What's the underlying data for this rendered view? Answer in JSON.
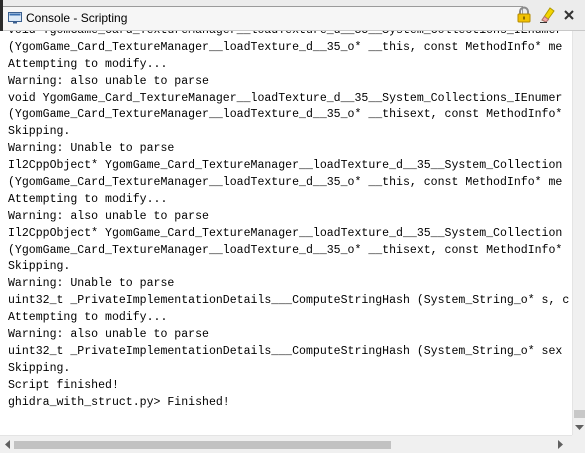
{
  "window": {
    "title": "Console - Scripting"
  },
  "toolbar": {
    "icons": {
      "console": "console-window-icon",
      "lock": "lock-icon",
      "clear": "eraser-icon",
      "close": "close-icon"
    },
    "colors": {
      "lock": "#d9a400",
      "clear": "#e6c400",
      "close": "#333333"
    }
  },
  "console": {
    "lines": [
      "void YgomGame_Card_TextureManager__loadTexture_d__35__System_Collections_IEnumer",
      "(YgomGame_Card_TextureManager__loadTexture_d__35_o* __this, const MethodInfo* me",
      "Attempting to modify...",
      "Warning: also unable to parse",
      "void YgomGame_Card_TextureManager__loadTexture_d__35__System_Collections_IEnumer",
      "(YgomGame_Card_TextureManager__loadTexture_d__35_o* __thisext, const MethodInfo*",
      "Skipping.",
      "Warning: Unable to parse",
      "Il2CppObject* YgomGame_Card_TextureManager__loadTexture_d__35__System_Collection",
      "(YgomGame_Card_TextureManager__loadTexture_d__35_o* __this, const MethodInfo* me",
      "Attempting to modify...",
      "Warning: also unable to parse",
      "Il2CppObject* YgomGame_Card_TextureManager__loadTexture_d__35__System_Collection",
      "(YgomGame_Card_TextureManager__loadTexture_d__35_o* __thisext, const MethodInfo*",
      "Skipping.",
      "Warning: Unable to parse",
      "uint32_t _PrivateImplementationDetails___ComputeStringHash (System_String_o* s, c",
      "Attempting to modify...",
      "Warning: also unable to parse",
      "uint32_t _PrivateImplementationDetails___ComputeStringHash (System_String_o* sex",
      "Skipping.",
      "Script finished!",
      "ghidra_with_struct.py> Finished!"
    ]
  }
}
